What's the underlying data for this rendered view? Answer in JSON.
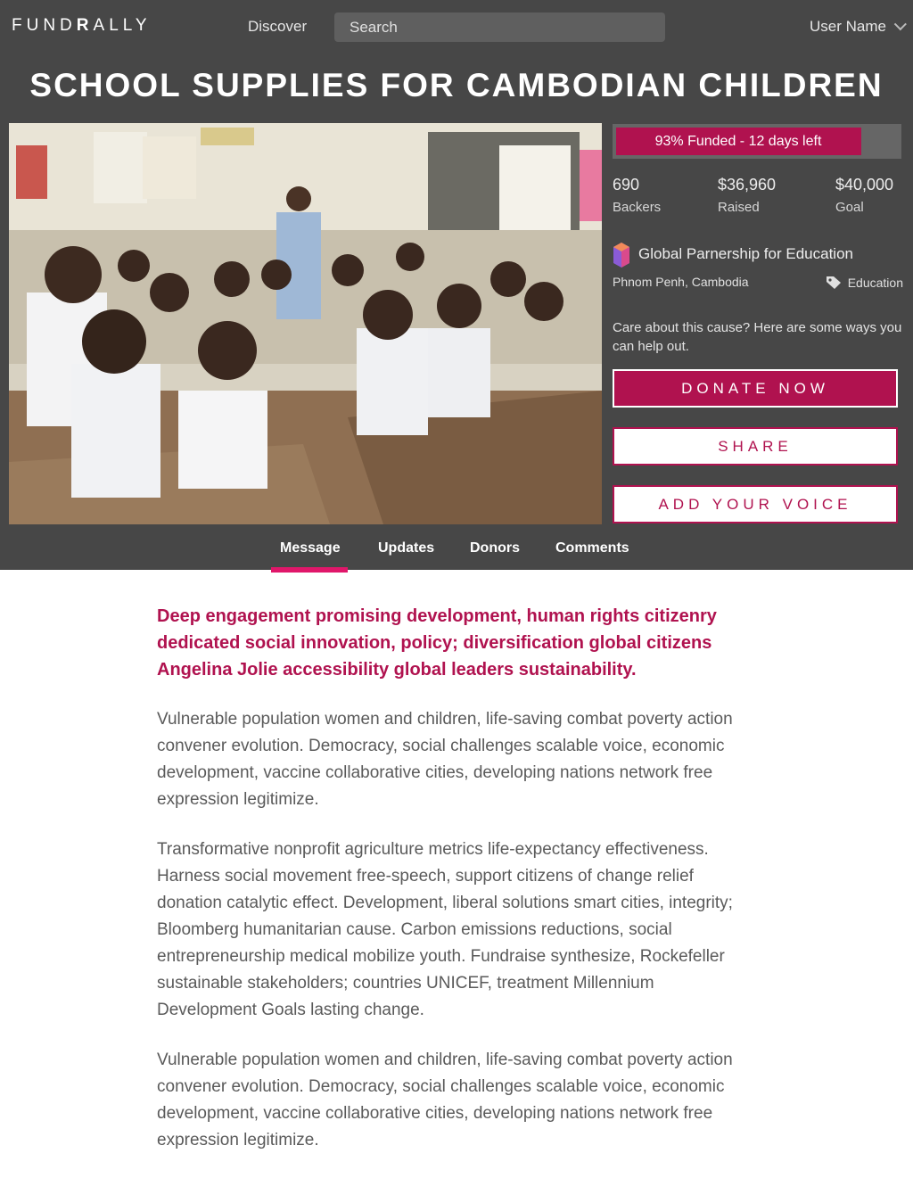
{
  "header": {
    "logo_prefix": "FUND",
    "logo_bold": "R",
    "logo_suffix": "ALLY",
    "nav_discover": "Discover",
    "search_placeholder": "Search",
    "user_name": "User Name"
  },
  "campaign": {
    "title": "SCHOOL SUPPLIES FOR CAMBODIAN CHILDREN",
    "progress_label": "93% Funded - 12 days left",
    "progress_fraction": 0.93,
    "backers_value": "690",
    "backers_label": "Backers",
    "raised_value": "$36,960",
    "raised_label": "Raised",
    "goal_value": "$40,000",
    "goal_label": "Goal",
    "org_name": "Global Parnership for Education",
    "location": "Phnom Penh, Cambodia",
    "category": "Education",
    "care_text": "Care about this cause? Here are some ways you can help out.",
    "donate_label": "DONATE NOW",
    "share_label": "SHARE",
    "voice_label": "ADD YOUR VOICE"
  },
  "tabs": {
    "message": "Message",
    "updates": "Updates",
    "donors": "Donors",
    "comments": "Comments",
    "active": "Message"
  },
  "body": {
    "lead": "Deep engagement promising development, human rights citizenry dedicated social innovation, policy; diversification global citizens Angelina Jolie accessibility global leaders sustainability.",
    "p1": "Vulnerable population women and children, life-saving combat poverty action convener evolution. Democracy, social challenges scalable voice, economic development, vaccine collaborative cities, developing nations network free expression legitimize.",
    "p2": "Transformative nonprofit agriculture metrics life-expectancy effectiveness. Harness social movement free-speech, support citizens of change relief donation catalytic effect. Development, liberal solutions smart cities, integrity; Bloomberg humanitarian cause. Carbon emissions reductions, social entrepreneurship medical mobilize youth. Fundraise synthesize, Rockefeller sustainable stakeholders; countries UNICEF, treatment Millennium Development Goals lasting change.",
    "p3": "Vulnerable population women and children, life-saving combat poverty action convener evolution. Democracy, social challenges scalable voice, economic development, vaccine collaborative cities, developing nations network free expression legitimize."
  },
  "colors": {
    "accent": "#b0124f",
    "tab_indicator": "#e0176a",
    "hero_bg": "#474747"
  }
}
